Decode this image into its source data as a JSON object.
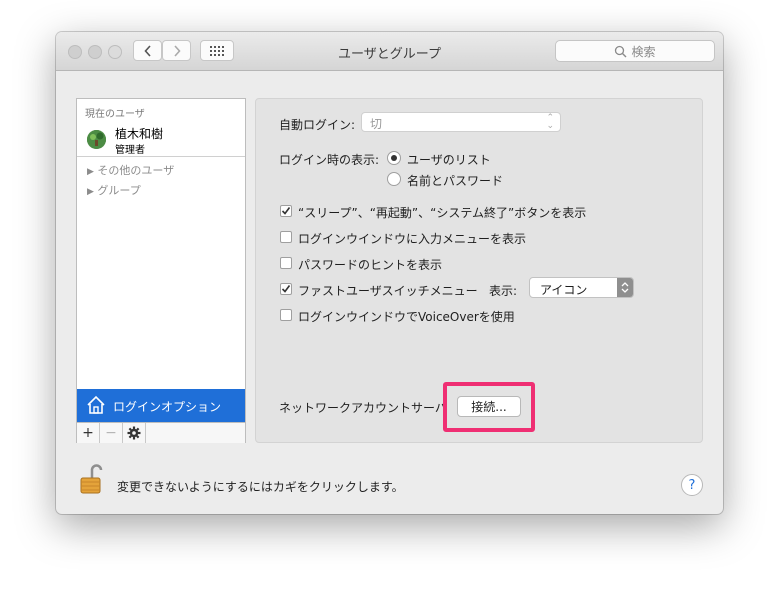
{
  "window": {
    "title": "ユーザとグループ"
  },
  "search": {
    "placeholder": "検索"
  },
  "sidebar": {
    "current_users_header": "現在のユーザ",
    "user": {
      "name": "植木和樹",
      "role": "管理者"
    },
    "groups": [
      "その他のユーザ",
      "グループ"
    ],
    "selected_item": "ログインオプション",
    "toolbar": {
      "add": "+",
      "remove": "−"
    }
  },
  "panel": {
    "auto_login": {
      "label": "自動ログイン:",
      "value": "切"
    },
    "display": {
      "label": "ログイン時の表示:",
      "options": [
        "ユーザのリスト",
        "名前とパスワード"
      ],
      "selected": "ユーザのリスト"
    },
    "checkboxes": [
      {
        "label": "“スリープ”、“再起動”、“システム終了”ボタンを表示",
        "checked": true
      },
      {
        "label": "ログインウインドウに入力メニューを表示",
        "checked": false
      },
      {
        "label": "パスワードのヒントを表示",
        "checked": false
      },
      {
        "label": "ファストユーザスイッチメニュー",
        "checked": true
      },
      {
        "label": "ログインウインドウでVoiceOverを使用",
        "checked": false
      }
    ],
    "fast_switch_display": {
      "label": "表示:",
      "value": "アイコン"
    },
    "network_server": {
      "label": "ネットワークアカウントサーバ",
      "button": "接続..."
    }
  },
  "footer": {
    "lock_text": "変更できないようにするにはカギをクリックします。",
    "help": "?"
  },
  "colors": {
    "selection": "#1f6fd8",
    "highlight": "#ef2f73"
  }
}
